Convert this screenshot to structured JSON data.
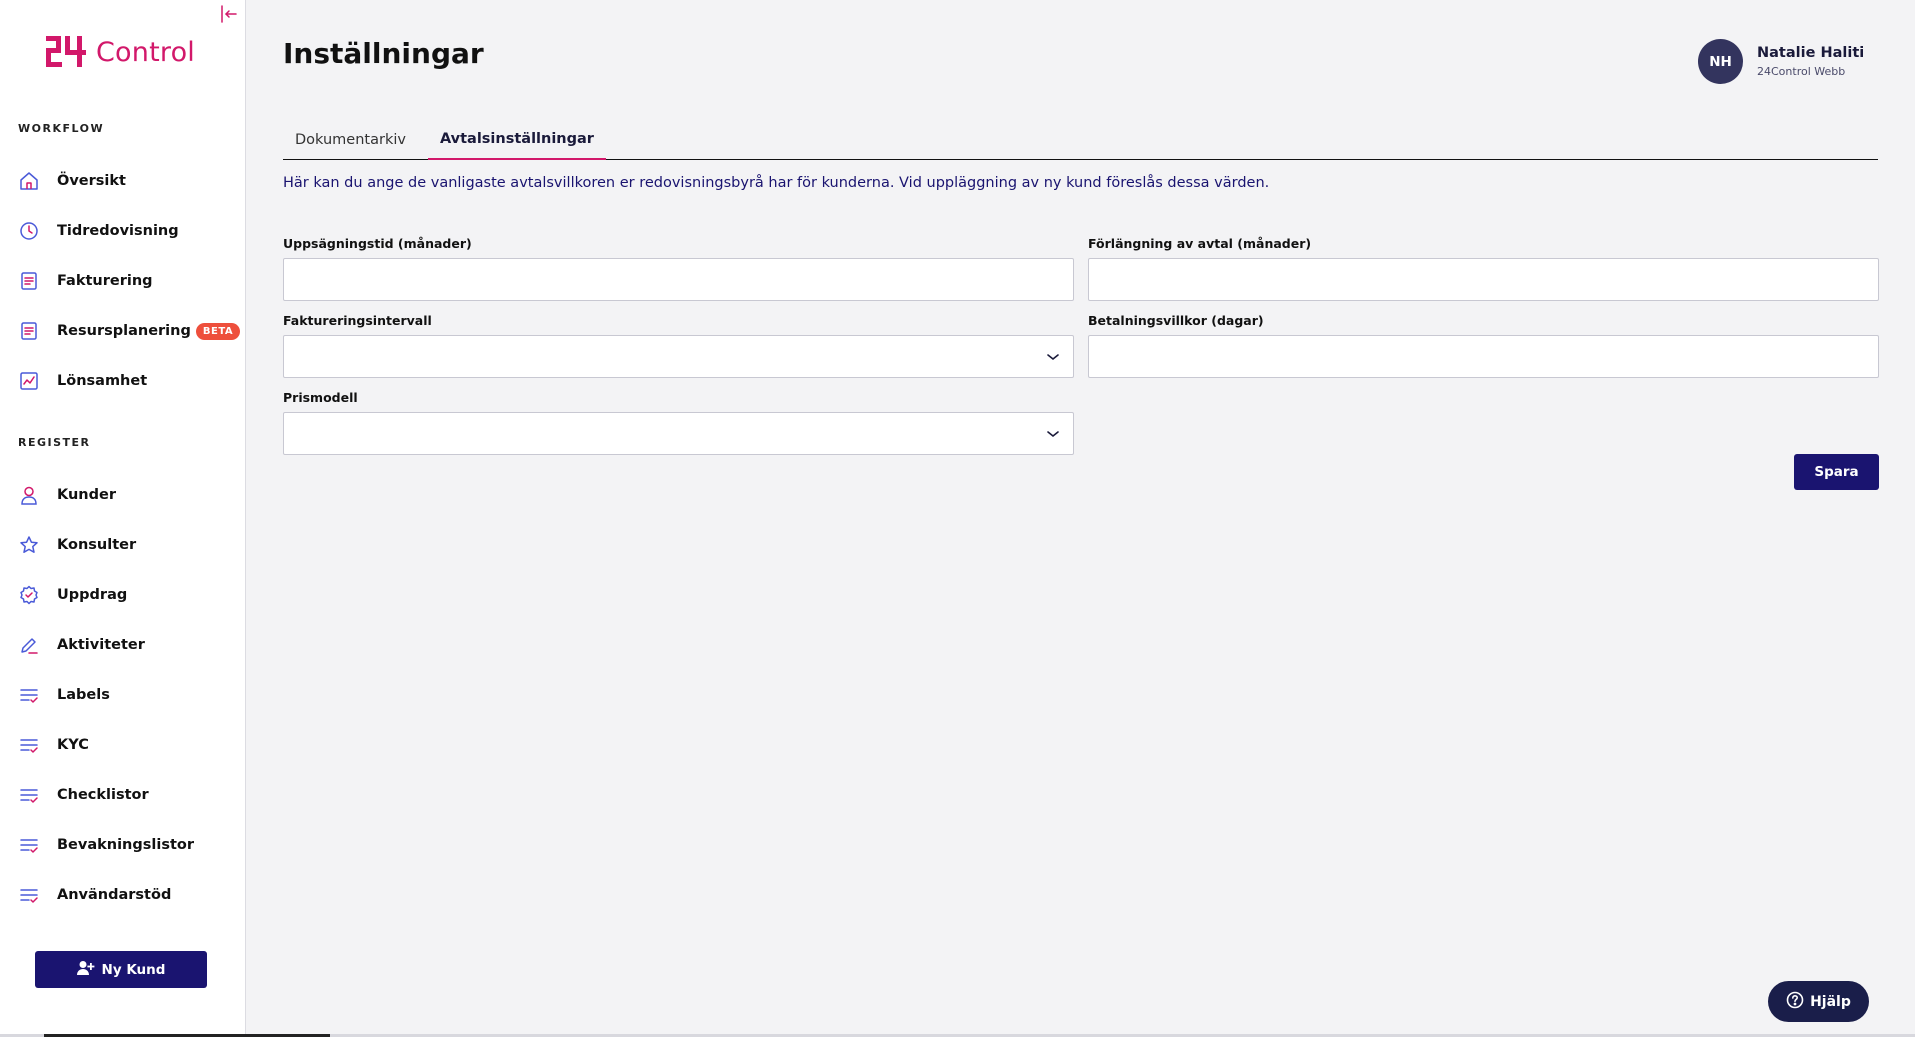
{
  "app": {
    "logo_text": "Control",
    "brand_color": "#d2186a",
    "primary_color": "#1a1470"
  },
  "sidebar": {
    "workflow_label": "WORKFLOW",
    "register_label": "REGISTER",
    "workflow_items": [
      {
        "label": "Översikt",
        "icon": "home-icon"
      },
      {
        "label": "Tidredovisning",
        "icon": "clock-icon"
      },
      {
        "label": "Fakturering",
        "icon": "document-icon"
      },
      {
        "label": "Resursplanering",
        "icon": "document-icon",
        "badge": "BETA"
      },
      {
        "label": "Lönsamhet",
        "icon": "chart-icon"
      }
    ],
    "register_items": [
      {
        "label": "Kunder",
        "icon": "user-icon"
      },
      {
        "label": "Konsulter",
        "icon": "star-icon"
      },
      {
        "label": "Uppdrag",
        "icon": "gear-icon"
      },
      {
        "label": "Aktiviteter",
        "icon": "pencil-icon"
      },
      {
        "label": "Labels",
        "icon": "list-check-icon"
      },
      {
        "label": "KYC",
        "icon": "list-check-icon"
      },
      {
        "label": "Checklistor",
        "icon": "list-check-icon"
      },
      {
        "label": "Bevakningslistor",
        "icon": "list-check-icon"
      },
      {
        "label": "Användarstöd",
        "icon": "list-check-icon"
      }
    ],
    "new_customer_label": "Ny Kund"
  },
  "header": {
    "title": "Inställningar",
    "user": {
      "initials": "NH",
      "name": "Natalie Haliti",
      "org": "24Control Webb"
    }
  },
  "tabs": [
    {
      "label": "Dokumentarkiv",
      "active": false
    },
    {
      "label": "Avtalsinställningar",
      "active": true
    }
  ],
  "intro_text": "Här kan du ange de vanligaste avtalsvillkoren er redovisningsbyrå har för kunderna. Vid uppläggning av ny kund föreslås dessa värden.",
  "form": {
    "notice_period_label": "Uppsägningstid (månader)",
    "notice_period_value": "",
    "extension_label": "Förlängning av avtal (månader)",
    "extension_value": "",
    "invoice_interval_label": "Faktureringsintervall",
    "invoice_interval_value": "",
    "payment_terms_label": "Betalningsvillkor (dagar)",
    "payment_terms_value": "",
    "price_model_label": "Prismodell",
    "price_model_value": "",
    "save_label": "Spara"
  },
  "help_label": "Hjälp"
}
